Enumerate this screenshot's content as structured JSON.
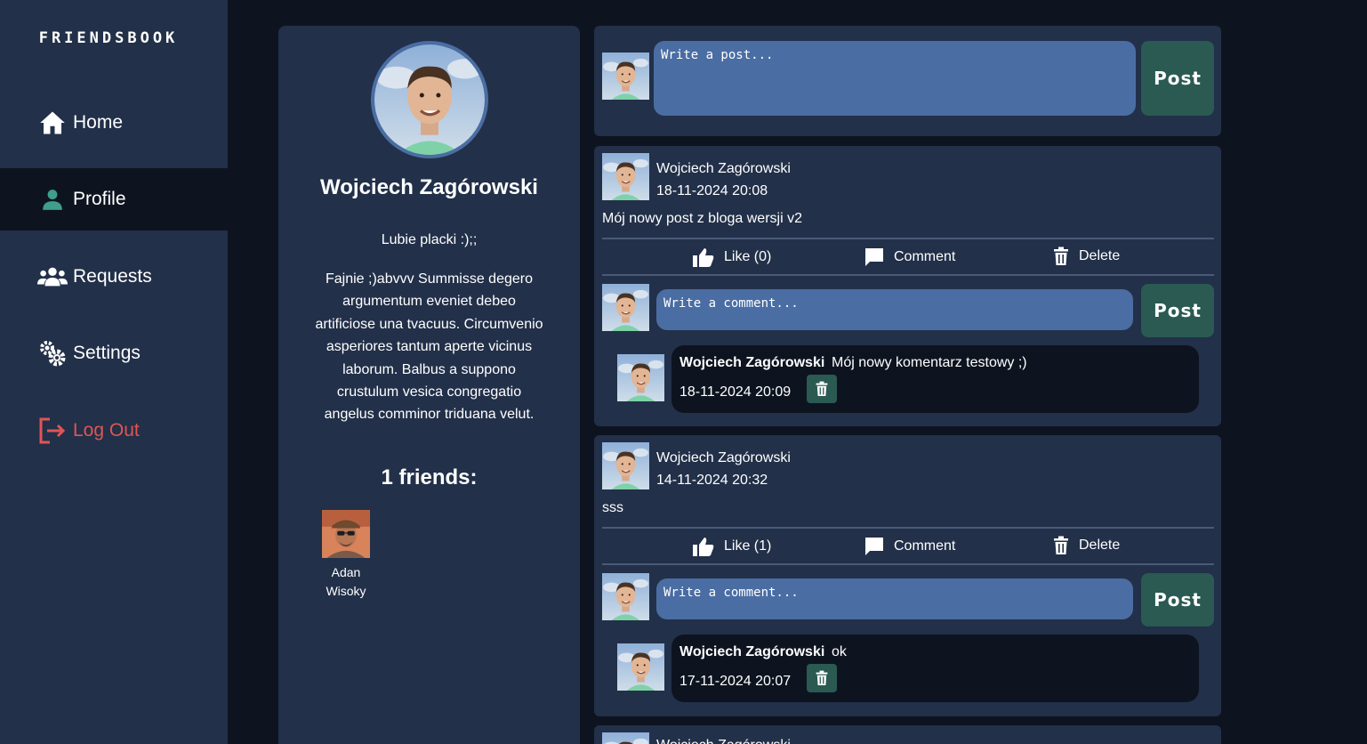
{
  "app": {
    "logo": "FRIENDSBOOK"
  },
  "sidebar": {
    "items": [
      {
        "label": "Home",
        "icon": "home-icon"
      },
      {
        "label": "Profile",
        "icon": "person-icon",
        "active": true
      },
      {
        "label": "Requests",
        "icon": "group-icon"
      },
      {
        "label": "Settings",
        "icon": "gears-icon"
      },
      {
        "label": "Log Out",
        "icon": "logout-icon"
      }
    ]
  },
  "profile": {
    "name": "Wojciech Zagórowski",
    "status": "Lubie placki :);;",
    "bio": "Fajnie ;)abvvv Summisse degero argumentum eveniet debeo artificiose una tvacuus. Circumvenio asperiores tantum aperte vicinus laborum. Balbus a suppono crustulum vesica congregatio angelus comminor triduana velut.",
    "friends_title": "1 friends:",
    "friends": [
      {
        "first": "Adan",
        "last": "Wisoky"
      }
    ]
  },
  "composer": {
    "placeholder": "Write a post...",
    "post_label": "Post"
  },
  "posts": [
    {
      "author": "Wojciech Zagórowski",
      "date": "18-11-2024 20:08",
      "text": "Mój nowy post z bloga wersji v2",
      "like_label": "Like (0)",
      "comment_label": "Comment",
      "delete_label": "Delete",
      "comment_placeholder": "Write a comment...",
      "comment_post_label": "Post",
      "comments": [
        {
          "author": "Wojciech Zagórowski",
          "text": "Mój nowy komentarz testowy ;)",
          "date": "18-11-2024 20:09"
        }
      ]
    },
    {
      "author": "Wojciech Zagórowski",
      "date": "14-11-2024 20:32",
      "text": "sss",
      "like_label": "Like (1)",
      "comment_label": "Comment",
      "delete_label": "Delete",
      "comment_placeholder": "Write a comment...",
      "comment_post_label": "Post",
      "comments": [
        {
          "author": "Wojciech Zagórowski",
          "text": "ok",
          "date": "17-11-2024 20:07"
        }
      ]
    },
    {
      "author": "Wojciech Zagórowski"
    }
  ],
  "colors": {
    "background": "#0d1420",
    "panel": "#223049",
    "input": "#4a6da3",
    "button": "#2a5a52",
    "logout": "#e05555",
    "accent": "#3f9e8c"
  }
}
